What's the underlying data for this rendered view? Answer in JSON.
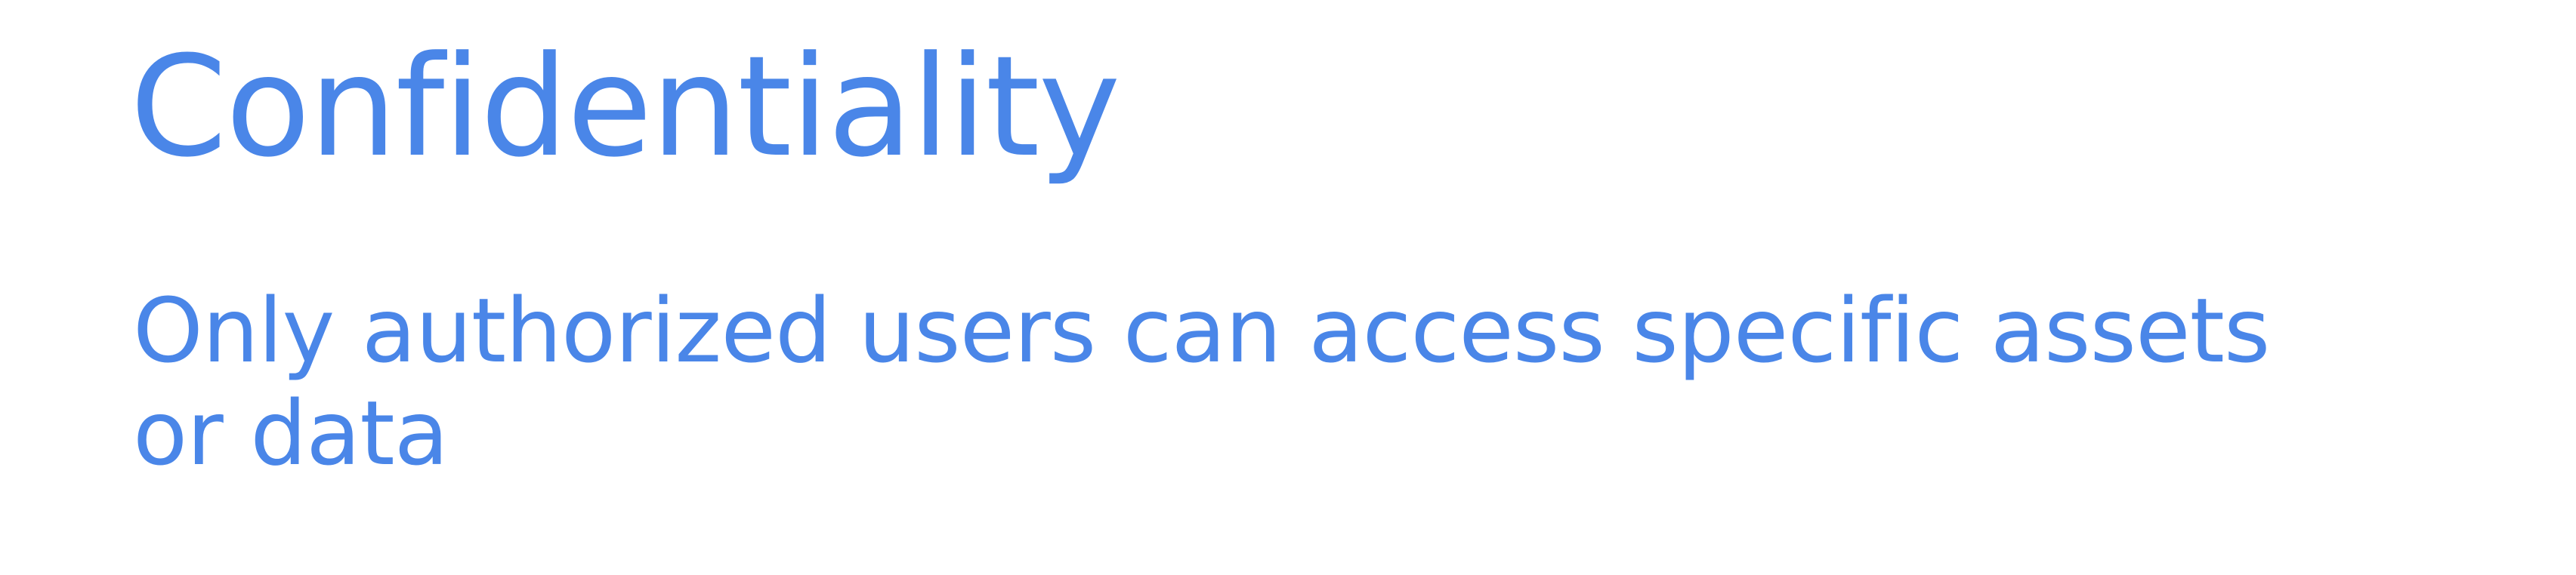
{
  "slide": {
    "title": "Confidentiality",
    "body_line_1": "Only authorized users can access specific assets",
    "body_line_2": "or data"
  },
  "colors": {
    "accent": "#4A86E8",
    "background": "#FFFFFF"
  }
}
